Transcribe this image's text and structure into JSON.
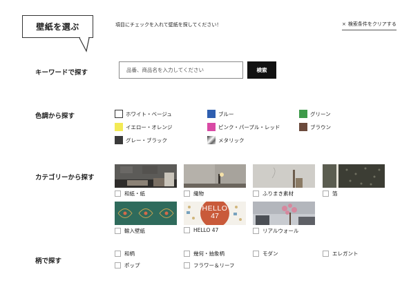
{
  "header": {
    "title": "壁紙を選ぶ",
    "intro": "項目にチェックを入れて壁紙を探してください！",
    "clear_icon": "×",
    "clear_label": "検索条件をクリアする"
  },
  "keyword": {
    "title": "キーワードで探す",
    "placeholder": "品番、商品名を入力してください",
    "button": "検索"
  },
  "colors": {
    "title": "色調から探す",
    "items": [
      {
        "label": "ホワイト・ベージュ",
        "color": "#ffffff"
      },
      {
        "label": "ブルー",
        "color": "#2f5fb0"
      },
      {
        "label": "グリーン",
        "color": "#3e9a4a"
      },
      {
        "label": "イエロー・オレンジ",
        "color": "#f3ea55"
      },
      {
        "label": "ピンク・パープル・レッド",
        "color": "#d94aa5"
      },
      {
        "label": "ブラウン",
        "color": "#6b4a3c"
      },
      {
        "label": "グレー・ブラック",
        "color": "#3a3a3a"
      },
      {
        "label": "メタリック",
        "color": "#9a9a9a"
      }
    ]
  },
  "categories": {
    "title": "カテゴリーから探す",
    "items": [
      {
        "label": "和紙・紙"
      },
      {
        "label": "織物"
      },
      {
        "label": "ふりまき素材"
      },
      {
        "label": "箔"
      },
      {
        "label": "輸入壁紙"
      },
      {
        "label": "HELLO 47",
        "badge_line1": "HELLO",
        "badge_line2": "47"
      },
      {
        "label": "リアルウォール"
      }
    ]
  },
  "patterns": {
    "title": "柄で探す",
    "items": [
      {
        "label": "和柄"
      },
      {
        "label": "幾何・抽象柄"
      },
      {
        "label": "モダン"
      },
      {
        "label": "エレガント"
      },
      {
        "label": "ポップ"
      },
      {
        "label": "フラワー＆リーフ"
      }
    ]
  },
  "theme": {
    "accent": "#111111",
    "badge": "#c95a3a"
  }
}
